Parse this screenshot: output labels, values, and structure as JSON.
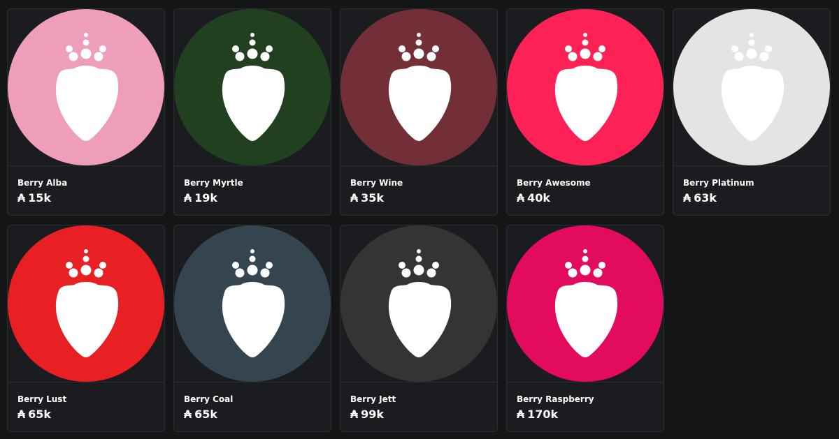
{
  "currency_symbol": "₳",
  "items": [
    {
      "name": "Berry Alba",
      "price": "15k",
      "color": "#ee9dba"
    },
    {
      "name": "Berry Myrtle",
      "price": "19k",
      "color": "#21401f"
    },
    {
      "name": "Berry Wine",
      "price": "35k",
      "color": "#722f37"
    },
    {
      "name": "Berry Awesome",
      "price": "40k",
      "color": "#fe2156"
    },
    {
      "name": "Berry Platinum",
      "price": "63k",
      "color": "#e5e4e2"
    },
    {
      "name": "Berry Lust",
      "price": "65k",
      "color": "#e81f23"
    },
    {
      "name": "Berry Coal",
      "price": "65k",
      "color": "#34454f"
    },
    {
      "name": "Berry Jett",
      "price": "99k",
      "color": "#343434"
    },
    {
      "name": "Berry Raspberry",
      "price": "170k",
      "color": "#e30b5d"
    }
  ]
}
